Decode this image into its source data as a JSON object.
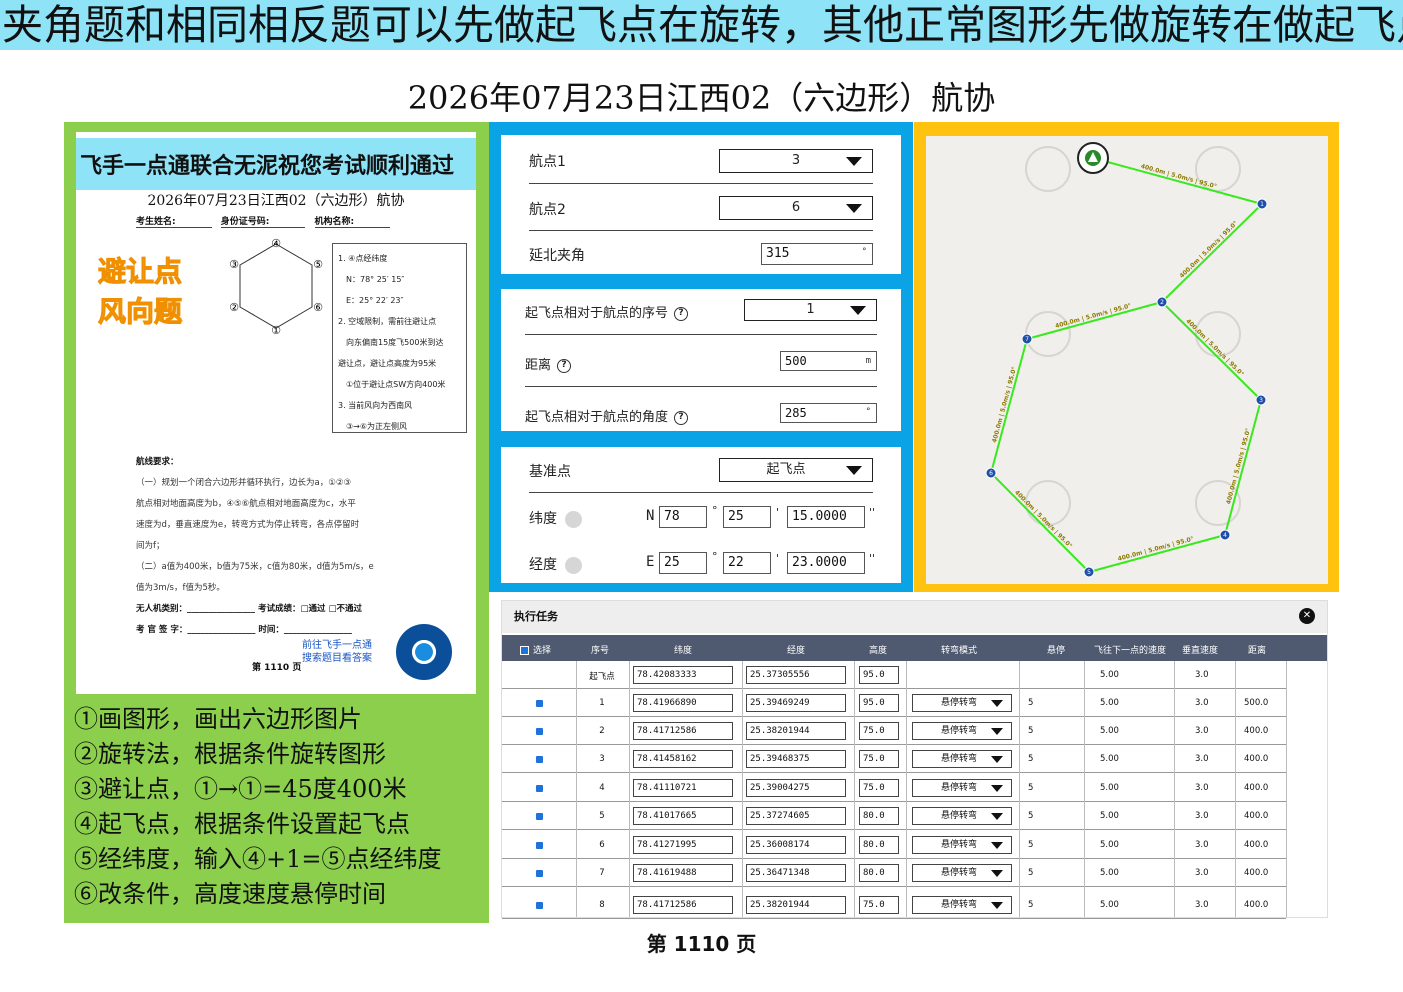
{
  "banner": "夹角题和相同相反题可以先做起飞点在旋转，其他正常图形先做旋转在做起飞点",
  "page_title": "2026年07月23日江西02（六边形）航协",
  "doc": {
    "header": "飞手一点通联合无泥祝您考试顺利通过",
    "title": "2026年07月23日江西02（六边形）航协",
    "fields": [
      "考生姓名:",
      "身份证号码:",
      "机构名称:"
    ],
    "avoid_lines": [
      "避让点",
      "风向题"
    ],
    "hex_labels": [
      "④",
      "⑤",
      "⑥",
      "①",
      "②",
      "③"
    ],
    "info": [
      "1. ④点经纬度",
      "N：78° 25′ 15″",
      "E：25° 22′ 23″",
      "2. 空域限制，需前往避让点",
      "向东偏南15度飞500米到达",
      "避让点，避让点高度为95米",
      "①位于避让点SW方向400米",
      "3. 当前风向为西南风",
      "③→⑥为正左侧风"
    ],
    "req_head": "航线要求：",
    "reqs": [
      "（一）规划一个闭合六边形并循环执行，边长为a，①②③",
      "航点相对地面高度为b，④⑤⑥航点相对地面高度为c，水平",
      "速度为d，垂直速度为e，转弯方式为停止转弯，各点停留时",
      "间为f；",
      "（二）a值为400米，b值为75米，c值为80米，d值为5m/s，e",
      "值为3m/s，f值为5秒。"
    ],
    "foot1": "无人机类别：________________  考试成绩：□通过  □不通过",
    "foot2": "考 官 签 字：________________  时间：________________",
    "foot_link": [
      "前往飞手一点通",
      "搜索题目看答案"
    ],
    "foot_page": "第 1110 页"
  },
  "steps": [
    "①画图形，画出六边形图片",
    "②旋转法，根据条件旋转图形",
    "③避让点，①→①=45度400米",
    "④起飞点，根据条件设置起飞点",
    "⑤经纬度，输入④+1=⑤点经纬度",
    "⑥改条件，高度速度悬停时间"
  ],
  "form1": {
    "wp1_label": "航点1",
    "wp1_value": "3",
    "wp2_label": "航点2",
    "wp2_value": "6",
    "angle_label": "延北夹角",
    "angle_value": "315",
    "angle_unit": "°"
  },
  "form2": {
    "seq_label": "起飞点相对于航点的序号",
    "seq_value": "1",
    "dist_label": "距离",
    "dist_value": "500",
    "dist_unit": "m",
    "ang_label": "起飞点相对于航点的角度",
    "ang_value": "285",
    "ang_unit": "°"
  },
  "form3": {
    "base_label": "基准点",
    "base_value": "起飞点",
    "lat_label": "纬度",
    "lat_hemi": "N",
    "lat_deg": "78",
    "lat_min": "25",
    "lat_sec": "15.0000",
    "lon_label": "经度",
    "lon_hemi": "E",
    "lon_deg": "25",
    "lon_min": "22",
    "lon_sec": "23.0000",
    "deg_mark": "°",
    "min_mark": "'",
    "sec_mark": "''"
  },
  "map": {
    "seg_label": "400.0m | 5.0m/s | 95.0°",
    "waypoints": [
      "1",
      "2",
      "3",
      "4",
      "5",
      "6",
      "7"
    ],
    "route_color": "#39e81f",
    "wp_color": "#1f4fa8"
  },
  "task": {
    "title": "执行任务",
    "close": "✕",
    "headers": [
      "选择",
      "序号",
      "纬度",
      "经度",
      "高度",
      "转弯模式",
      "悬停",
      "飞往下一点的速度",
      "垂直速度",
      "距离"
    ],
    "rows": [
      {
        "seq": "起飞点",
        "lat": "78.42083333",
        "lon": "25.37305556",
        "alt": "95.0",
        "turn": "",
        "hover": "",
        "speed": "5.00",
        "vspeed": "3.0",
        "dist": "",
        "check": false
      },
      {
        "seq": "1",
        "lat": "78.41966890",
        "lon": "25.39469249",
        "alt": "95.0",
        "turn": "悬停转弯",
        "hover": "5",
        "speed": "5.00",
        "vspeed": "3.0",
        "dist": "500.0",
        "check": true
      },
      {
        "seq": "2",
        "lat": "78.41712586",
        "lon": "25.38201944",
        "alt": "75.0",
        "turn": "悬停转弯",
        "hover": "5",
        "speed": "5.00",
        "vspeed": "3.0",
        "dist": "400.0",
        "check": true
      },
      {
        "seq": "3",
        "lat": "78.41458162",
        "lon": "25.39468375",
        "alt": "75.0",
        "turn": "悬停转弯",
        "hover": "5",
        "speed": "5.00",
        "vspeed": "3.0",
        "dist": "400.0",
        "check": true
      },
      {
        "seq": "4",
        "lat": "78.41110721",
        "lon": "25.39004275",
        "alt": "75.0",
        "turn": "悬停转弯",
        "hover": "5",
        "speed": "5.00",
        "vspeed": "3.0",
        "dist": "400.0",
        "check": true
      },
      {
        "seq": "5",
        "lat": "78.41017665",
        "lon": "25.37274605",
        "alt": "80.0",
        "turn": "悬停转弯",
        "hover": "5",
        "speed": "5.00",
        "vspeed": "3.0",
        "dist": "400.0",
        "check": true
      },
      {
        "seq": "6",
        "lat": "78.41271995",
        "lon": "25.36008174",
        "alt": "80.0",
        "turn": "悬停转弯",
        "hover": "5",
        "speed": "5.00",
        "vspeed": "3.0",
        "dist": "400.0",
        "check": true
      },
      {
        "seq": "7",
        "lat": "78.41619488",
        "lon": "25.36471348",
        "alt": "80.0",
        "turn": "悬停转弯",
        "hover": "5",
        "speed": "5.00",
        "vspeed": "3.0",
        "dist": "400.0",
        "check": true
      },
      {
        "seq": "8",
        "lat": "78.41712586",
        "lon": "25.38201944",
        "alt": "75.0",
        "turn": "悬停转弯",
        "hover": "5",
        "speed": "5.00",
        "vspeed": "3.0",
        "dist": "400.0",
        "check": true
      }
    ]
  },
  "page_no": "第 1110 页"
}
